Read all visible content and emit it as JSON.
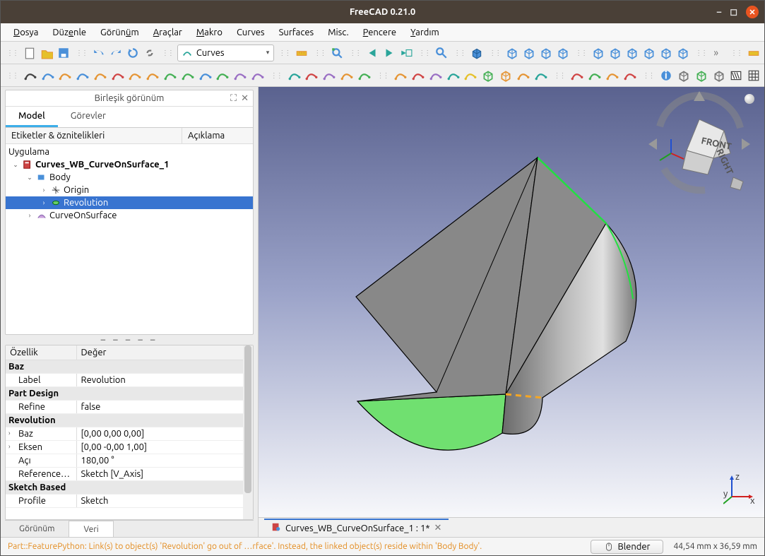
{
  "title": "FreeCAD 0.21.0",
  "menu": [
    "Dosya",
    "Düzenle",
    "Görünüm",
    "Araçlar",
    "Makro",
    "Curves",
    "Surfaces",
    "Misc.",
    "Pencere",
    "Yardım"
  ],
  "menu_accel": [
    0,
    3,
    5,
    0,
    0,
    -1,
    -1,
    -1,
    0,
    0
  ],
  "workbench": "Curves",
  "panel_title": "Birleşik görünüm",
  "tabs": {
    "model": "Model",
    "tasks": "Görevler"
  },
  "tree_headers": {
    "labels": "Etiketler & öznitelikleri",
    "desc": "Açıklama"
  },
  "tree_root": "Uygulama",
  "tree": {
    "doc": "Curves_WB_CurveOnSurface_1",
    "body": "Body",
    "origin": "Origin",
    "revolution": "Revolution",
    "cos": "CurveOnSurface"
  },
  "prop_headers": {
    "prop": "Özellik",
    "val": "Değer"
  },
  "props": {
    "group_baz": "Baz",
    "label_k": "Label",
    "label_v": "Revolution",
    "group_pd": "Part Design",
    "refine_k": "Refine",
    "refine_v": "false",
    "group_rev": "Revolution",
    "baz_k": "Baz",
    "baz_v": "[0,00 0,00 0,00]",
    "eksen_k": "Eksen",
    "eksen_v": "[0,00 -0,00 1,00]",
    "aci_k": "Açı",
    "aci_v": "180,00 °",
    "ref_k": "Reference…",
    "ref_v": "Sketch [V_Axis]",
    "group_sb": "Sketch Based",
    "profile_k": "Profile",
    "profile_v": "Sketch"
  },
  "prop_tabs": {
    "view": "Görünüm",
    "data": "Veri"
  },
  "doc_tab": "Curves_WB_CurveOnSurface_1 : 1*",
  "status": "Part::FeaturePython: Link(s) to object(s) 'Revolution' go out of …rface'. Instead, the linked object(s) reside within 'Body Body'.",
  "nav_style": "Blender",
  "dimensions": "44,54 mm x 36,59 mm",
  "navcube": {
    "front": "FRONT",
    "right": "RIGHT"
  },
  "axes": {
    "x": "x",
    "y": "y",
    "z": "z"
  },
  "toolbar1_icons": [
    "new-file",
    "open-file",
    "save-file",
    "sep",
    "undo",
    "redo",
    "refresh",
    "link",
    "sep",
    "workbench",
    "sep",
    "measure",
    "sep",
    "fit-all",
    "sep",
    "nav-back",
    "nav-fwd",
    "nav-linked",
    "sep",
    "zoom",
    "sep",
    "cube-main",
    "sep",
    "iso1",
    "iso2",
    "iso3",
    "iso4",
    "sep",
    "front",
    "top",
    "right",
    "rear",
    "bottom",
    "left",
    "sep",
    "more",
    "sep",
    "measure2"
  ],
  "toolbar2_icons": [
    "line",
    "bspline-edit",
    "bspline",
    "arc-tool",
    "join",
    "extend",
    "split",
    "freehand",
    "spiral",
    "profile",
    "curve-lin",
    "curve-green",
    "surface-extend",
    "shape",
    "sep",
    "surface-net",
    "surface-rev",
    "shell",
    "fill",
    "surface-ed",
    "sep",
    "curve-net",
    "spline3d",
    "sphere",
    "circle",
    "cyl",
    "cube3d",
    "box",
    "planar",
    "widget",
    "sep",
    "cprofile",
    "rail",
    "sweep",
    "sweep2",
    "sep",
    "info",
    "body",
    "box-solid",
    "plane",
    "zebra",
    "grid"
  ],
  "colors": {
    "titlebar": "#4a4037",
    "accent": "#3daee9",
    "selection": "#3874d0",
    "close": "#e95420",
    "warn": "#e38b1e",
    "face_highlight": "#70e070"
  }
}
